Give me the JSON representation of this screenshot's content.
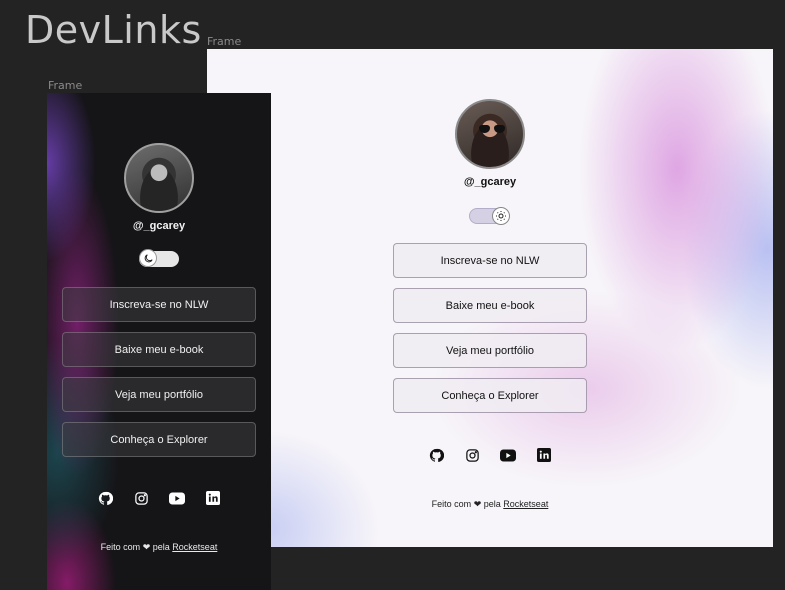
{
  "board": {
    "title": "DevLinks"
  },
  "frames": {
    "light_label": "Frame",
    "dark_label": "Frame"
  },
  "profile": {
    "handle": "@_gcarey"
  },
  "buttons": [
    {
      "label": "Inscreva-se no NLW"
    },
    {
      "label": "Baixe meu e-book"
    },
    {
      "label": "Veja meu portfólio"
    },
    {
      "label": "Conheça o Explorer"
    }
  ],
  "socials": [
    {
      "icon": "github-icon"
    },
    {
      "icon": "instagram-icon"
    },
    {
      "icon": "youtube-icon"
    },
    {
      "icon": "linkedin-icon"
    }
  ],
  "footer": {
    "prefix": "Feito com",
    "middle": "pela",
    "link": "Rocketseat"
  },
  "colors": {
    "canvas": "#232323",
    "light_bg": "#f7f5f9",
    "dark_bg": "#151417"
  }
}
